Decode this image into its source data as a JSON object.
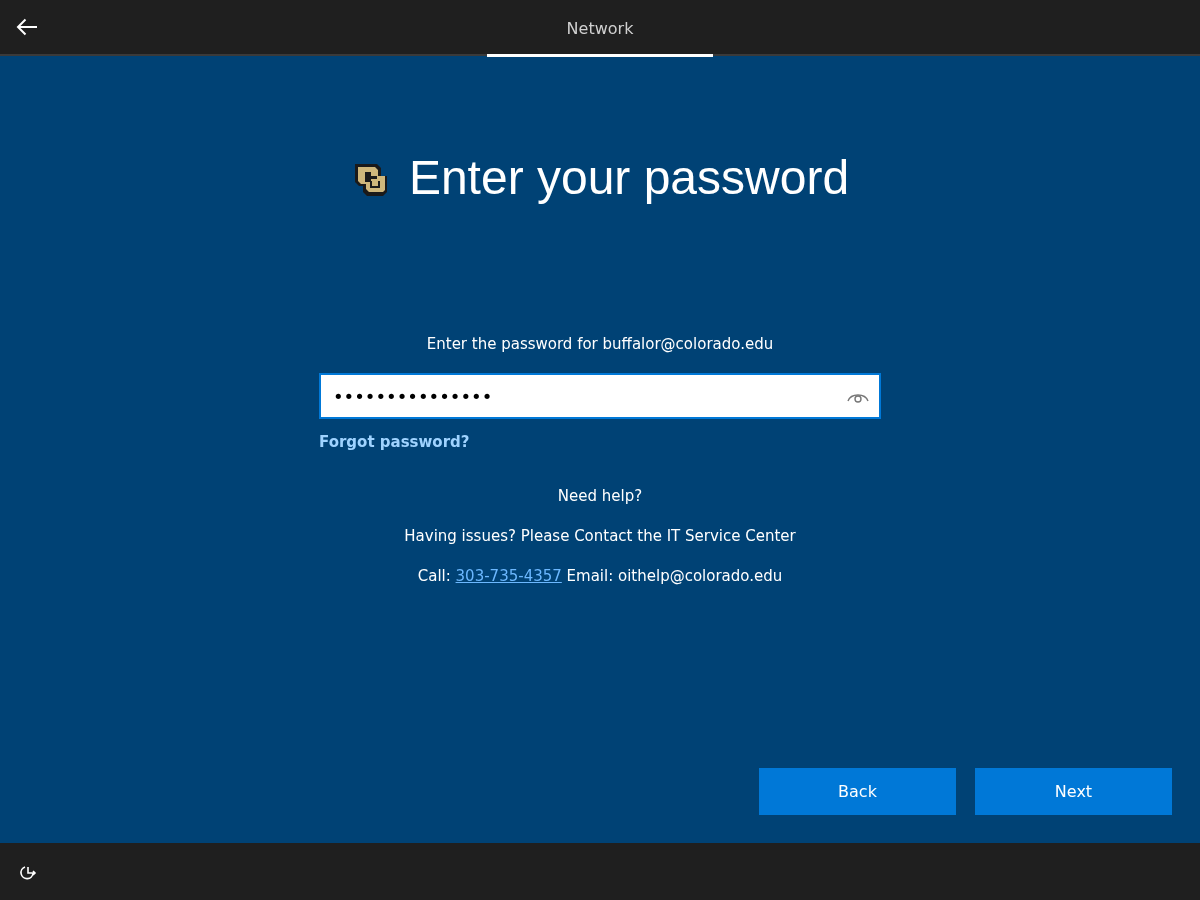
{
  "header": {
    "tabs": [
      {
        "label": "Network",
        "selected": true
      }
    ]
  },
  "title": "Enter your password",
  "prompt": "Enter the password for buffalor@colorado.edu",
  "password_field": {
    "value": "•••••••••••••••"
  },
  "forgot_link": "Forgot password?",
  "help": {
    "heading": "Need help?",
    "message": "Having issues? Please Contact the IT Service Center",
    "call_label": "Call:",
    "phone": "303-735-4357",
    "email_text": "Email: oithelp@colorado.edu"
  },
  "buttons": [
    {
      "label": "Back"
    },
    {
      "label": "Next"
    }
  ]
}
